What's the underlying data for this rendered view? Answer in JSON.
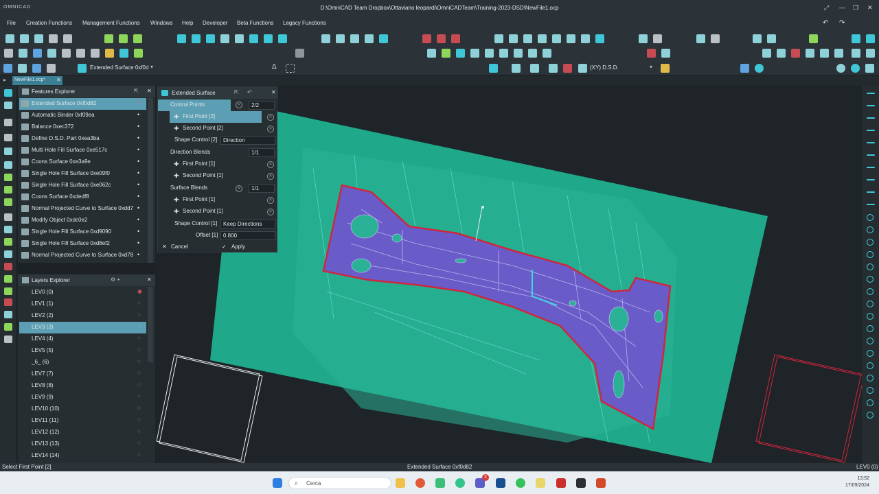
{
  "window": {
    "logo": "OMNICAD",
    "title": "D:\\OmniCAD Team Dropbox\\Ottaviano leopardi\\OmniCADTeam\\Training-2023-DSD\\NewFile1.ocp"
  },
  "menu": [
    "File",
    "Creation Functions",
    "Management Functions",
    "Windows",
    "Help",
    "Developer",
    "Beta Functions",
    "Legacy Functions"
  ],
  "toolbar": {
    "current_command": "Extended Surface 0xf0d",
    "view_mode": "(XY) D.S.D."
  },
  "doc_tab": "NewFile1.ocp*",
  "features_explorer": {
    "title": "Features Explorer",
    "items": [
      {
        "label": "Extended Surface 0xf0d82",
        "selected": true,
        "mark": "*"
      },
      {
        "label": "Automatic Binder 0xf09ea",
        "mark": "•"
      },
      {
        "label": "Balance 0xec372",
        "mark": "•"
      },
      {
        "label": "Define D.S.D. Part 0xea3ba",
        "mark": "•"
      },
      {
        "label": "Multi Hole Fill Surface 0xe517c",
        "mark": "•"
      },
      {
        "label": "Coons Surface 0xe3a9e",
        "mark": "•"
      },
      {
        "label": "Single Hole Fill Surface 0xe09f0",
        "mark": "•"
      },
      {
        "label": "Single Hole Fill Surface 0xe062c",
        "mark": "•"
      },
      {
        "label": "Coons Surface 0xdedf8",
        "mark": "•"
      },
      {
        "label": "Normal Projected Curve to Surface 0xdd7",
        "mark": "•"
      },
      {
        "label": "Modify Object 0xdc0e2",
        "mark": "•"
      },
      {
        "label": "Single Hole Fill Surface 0xd9090",
        "mark": "•"
      },
      {
        "label": "Single Hole Fill Surface 0xd8ef2",
        "mark": "•"
      },
      {
        "label": "Normal Projected Curve to Surface 0xd78",
        "mark": "•"
      }
    ]
  },
  "layers_explorer": {
    "title": "Layers Explorer",
    "items": [
      {
        "label": "LEV0 (0)"
      },
      {
        "label": "LEV1 (1)"
      },
      {
        "label": "LEV2 (2)"
      },
      {
        "label": "LEV3 (3)",
        "selected": true
      },
      {
        "label": "LEV4 (4)"
      },
      {
        "label": "LEV5 (5)"
      },
      {
        "label": "_6_ (6)"
      },
      {
        "label": "LEV7 (7)"
      },
      {
        "label": "LEV8 (8)"
      },
      {
        "label": "LEV9 (9)"
      },
      {
        "label": "LEV10 (10)"
      },
      {
        "label": "LEV11 (11)"
      },
      {
        "label": "LEV12 (12)"
      },
      {
        "label": "LEV13 (13)"
      },
      {
        "label": "LEV14 (14)"
      }
    ]
  },
  "extended_surface": {
    "title": "Extended Surface",
    "control_points": "Control Points",
    "cp_count": "2/2",
    "first_point_2": "First Point [2]",
    "second_point_2": "Second Point [2]",
    "shape_control_2": "Shape Control [2]",
    "shape_control_2_value": "Direction",
    "direction_blends": "Direction Blends",
    "db_count": "1/1",
    "db_first": "First Point [1]",
    "db_second": "Second Point [1]",
    "surface_blends": "Surface Blends",
    "sb_count": "1/1",
    "sb_first": "First Point [1]",
    "sb_second": "Second Point [1]",
    "shape_control_1": "Shape Control [1]",
    "shape_control_1_value": "Keep Directions",
    "offset_label": "Offset [1]",
    "offset_value": "0.800",
    "cancel": "Cancel",
    "apply": "Apply"
  },
  "status": {
    "prompt": "Select First Point [2]",
    "center": "Extended Surface 0xf0d82",
    "right": "LEV0 (0)"
  },
  "taskbar": {
    "search": "Cerca",
    "time": "13:52",
    "date": "17/09/2024",
    "badge": "2"
  },
  "colors": {
    "accent": "#5c9fb5",
    "surface_green": "#1fa88a",
    "part_purple": "#6a5cc8",
    "boundary_red": "#d0263c"
  }
}
